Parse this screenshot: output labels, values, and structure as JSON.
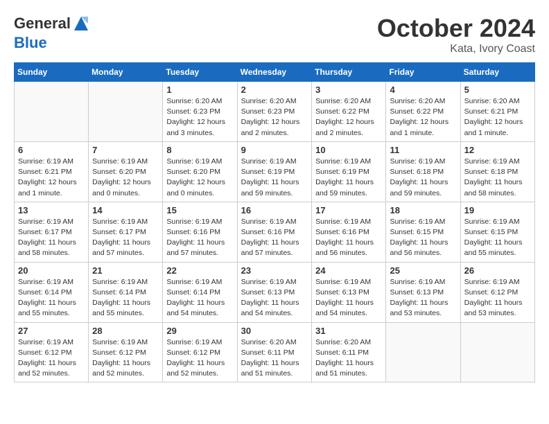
{
  "header": {
    "logo_line1": "General",
    "logo_line2": "Blue",
    "month": "October 2024",
    "location": "Kata, Ivory Coast"
  },
  "weekdays": [
    "Sunday",
    "Monday",
    "Tuesday",
    "Wednesday",
    "Thursday",
    "Friday",
    "Saturday"
  ],
  "weeks": [
    [
      {
        "day": "",
        "info": ""
      },
      {
        "day": "",
        "info": ""
      },
      {
        "day": "1",
        "info": "Sunrise: 6:20 AM\nSunset: 6:23 PM\nDaylight: 12 hours and 3 minutes."
      },
      {
        "day": "2",
        "info": "Sunrise: 6:20 AM\nSunset: 6:23 PM\nDaylight: 12 hours and 2 minutes."
      },
      {
        "day": "3",
        "info": "Sunrise: 6:20 AM\nSunset: 6:22 PM\nDaylight: 12 hours and 2 minutes."
      },
      {
        "day": "4",
        "info": "Sunrise: 6:20 AM\nSunset: 6:22 PM\nDaylight: 12 hours and 1 minute."
      },
      {
        "day": "5",
        "info": "Sunrise: 6:20 AM\nSunset: 6:21 PM\nDaylight: 12 hours and 1 minute."
      }
    ],
    [
      {
        "day": "6",
        "info": "Sunrise: 6:19 AM\nSunset: 6:21 PM\nDaylight: 12 hours and 1 minute."
      },
      {
        "day": "7",
        "info": "Sunrise: 6:19 AM\nSunset: 6:20 PM\nDaylight: 12 hours and 0 minutes."
      },
      {
        "day": "8",
        "info": "Sunrise: 6:19 AM\nSunset: 6:20 PM\nDaylight: 12 hours and 0 minutes."
      },
      {
        "day": "9",
        "info": "Sunrise: 6:19 AM\nSunset: 6:19 PM\nDaylight: 11 hours and 59 minutes."
      },
      {
        "day": "10",
        "info": "Sunrise: 6:19 AM\nSunset: 6:19 PM\nDaylight: 11 hours and 59 minutes."
      },
      {
        "day": "11",
        "info": "Sunrise: 6:19 AM\nSunset: 6:18 PM\nDaylight: 11 hours and 59 minutes."
      },
      {
        "day": "12",
        "info": "Sunrise: 6:19 AM\nSunset: 6:18 PM\nDaylight: 11 hours and 58 minutes."
      }
    ],
    [
      {
        "day": "13",
        "info": "Sunrise: 6:19 AM\nSunset: 6:17 PM\nDaylight: 11 hours and 58 minutes."
      },
      {
        "day": "14",
        "info": "Sunrise: 6:19 AM\nSunset: 6:17 PM\nDaylight: 11 hours and 57 minutes."
      },
      {
        "day": "15",
        "info": "Sunrise: 6:19 AM\nSunset: 6:16 PM\nDaylight: 11 hours and 57 minutes."
      },
      {
        "day": "16",
        "info": "Sunrise: 6:19 AM\nSunset: 6:16 PM\nDaylight: 11 hours and 57 minutes."
      },
      {
        "day": "17",
        "info": "Sunrise: 6:19 AM\nSunset: 6:16 PM\nDaylight: 11 hours and 56 minutes."
      },
      {
        "day": "18",
        "info": "Sunrise: 6:19 AM\nSunset: 6:15 PM\nDaylight: 11 hours and 56 minutes."
      },
      {
        "day": "19",
        "info": "Sunrise: 6:19 AM\nSunset: 6:15 PM\nDaylight: 11 hours and 55 minutes."
      }
    ],
    [
      {
        "day": "20",
        "info": "Sunrise: 6:19 AM\nSunset: 6:14 PM\nDaylight: 11 hours and 55 minutes."
      },
      {
        "day": "21",
        "info": "Sunrise: 6:19 AM\nSunset: 6:14 PM\nDaylight: 11 hours and 55 minutes."
      },
      {
        "day": "22",
        "info": "Sunrise: 6:19 AM\nSunset: 6:14 PM\nDaylight: 11 hours and 54 minutes."
      },
      {
        "day": "23",
        "info": "Sunrise: 6:19 AM\nSunset: 6:13 PM\nDaylight: 11 hours and 54 minutes."
      },
      {
        "day": "24",
        "info": "Sunrise: 6:19 AM\nSunset: 6:13 PM\nDaylight: 11 hours and 54 minutes."
      },
      {
        "day": "25",
        "info": "Sunrise: 6:19 AM\nSunset: 6:13 PM\nDaylight: 11 hours and 53 minutes."
      },
      {
        "day": "26",
        "info": "Sunrise: 6:19 AM\nSunset: 6:12 PM\nDaylight: 11 hours and 53 minutes."
      }
    ],
    [
      {
        "day": "27",
        "info": "Sunrise: 6:19 AM\nSunset: 6:12 PM\nDaylight: 11 hours and 52 minutes."
      },
      {
        "day": "28",
        "info": "Sunrise: 6:19 AM\nSunset: 6:12 PM\nDaylight: 11 hours and 52 minutes."
      },
      {
        "day": "29",
        "info": "Sunrise: 6:19 AM\nSunset: 6:12 PM\nDaylight: 11 hours and 52 minutes."
      },
      {
        "day": "30",
        "info": "Sunrise: 6:20 AM\nSunset: 6:11 PM\nDaylight: 11 hours and 51 minutes."
      },
      {
        "day": "31",
        "info": "Sunrise: 6:20 AM\nSunset: 6:11 PM\nDaylight: 11 hours and 51 minutes."
      },
      {
        "day": "",
        "info": ""
      },
      {
        "day": "",
        "info": ""
      }
    ]
  ]
}
